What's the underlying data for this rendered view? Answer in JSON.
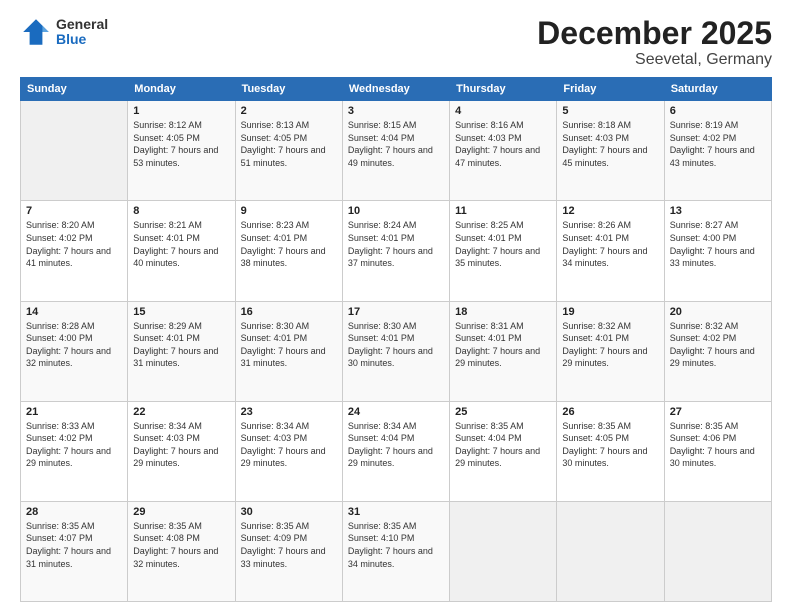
{
  "logo": {
    "general": "General",
    "blue": "Blue"
  },
  "title": "December 2025",
  "subtitle": "Seevetal, Germany",
  "weekdays": [
    "Sunday",
    "Monday",
    "Tuesday",
    "Wednesday",
    "Thursday",
    "Friday",
    "Saturday"
  ],
  "weeks": [
    [
      {
        "day": "",
        "sunrise": "",
        "sunset": "",
        "daylight": ""
      },
      {
        "day": "1",
        "sunrise": "Sunrise: 8:12 AM",
        "sunset": "Sunset: 4:05 PM",
        "daylight": "Daylight: 7 hours and 53 minutes."
      },
      {
        "day": "2",
        "sunrise": "Sunrise: 8:13 AM",
        "sunset": "Sunset: 4:05 PM",
        "daylight": "Daylight: 7 hours and 51 minutes."
      },
      {
        "day": "3",
        "sunrise": "Sunrise: 8:15 AM",
        "sunset": "Sunset: 4:04 PM",
        "daylight": "Daylight: 7 hours and 49 minutes."
      },
      {
        "day": "4",
        "sunrise": "Sunrise: 8:16 AM",
        "sunset": "Sunset: 4:03 PM",
        "daylight": "Daylight: 7 hours and 47 minutes."
      },
      {
        "day": "5",
        "sunrise": "Sunrise: 8:18 AM",
        "sunset": "Sunset: 4:03 PM",
        "daylight": "Daylight: 7 hours and 45 minutes."
      },
      {
        "day": "6",
        "sunrise": "Sunrise: 8:19 AM",
        "sunset": "Sunset: 4:02 PM",
        "daylight": "Daylight: 7 hours and 43 minutes."
      }
    ],
    [
      {
        "day": "7",
        "sunrise": "Sunrise: 8:20 AM",
        "sunset": "Sunset: 4:02 PM",
        "daylight": "Daylight: 7 hours and 41 minutes."
      },
      {
        "day": "8",
        "sunrise": "Sunrise: 8:21 AM",
        "sunset": "Sunset: 4:01 PM",
        "daylight": "Daylight: 7 hours and 40 minutes."
      },
      {
        "day": "9",
        "sunrise": "Sunrise: 8:23 AM",
        "sunset": "Sunset: 4:01 PM",
        "daylight": "Daylight: 7 hours and 38 minutes."
      },
      {
        "day": "10",
        "sunrise": "Sunrise: 8:24 AM",
        "sunset": "Sunset: 4:01 PM",
        "daylight": "Daylight: 7 hours and 37 minutes."
      },
      {
        "day": "11",
        "sunrise": "Sunrise: 8:25 AM",
        "sunset": "Sunset: 4:01 PM",
        "daylight": "Daylight: 7 hours and 35 minutes."
      },
      {
        "day": "12",
        "sunrise": "Sunrise: 8:26 AM",
        "sunset": "Sunset: 4:01 PM",
        "daylight": "Daylight: 7 hours and 34 minutes."
      },
      {
        "day": "13",
        "sunrise": "Sunrise: 8:27 AM",
        "sunset": "Sunset: 4:00 PM",
        "daylight": "Daylight: 7 hours and 33 minutes."
      }
    ],
    [
      {
        "day": "14",
        "sunrise": "Sunrise: 8:28 AM",
        "sunset": "Sunset: 4:00 PM",
        "daylight": "Daylight: 7 hours and 32 minutes."
      },
      {
        "day": "15",
        "sunrise": "Sunrise: 8:29 AM",
        "sunset": "Sunset: 4:01 PM",
        "daylight": "Daylight: 7 hours and 31 minutes."
      },
      {
        "day": "16",
        "sunrise": "Sunrise: 8:30 AM",
        "sunset": "Sunset: 4:01 PM",
        "daylight": "Daylight: 7 hours and 31 minutes."
      },
      {
        "day": "17",
        "sunrise": "Sunrise: 8:30 AM",
        "sunset": "Sunset: 4:01 PM",
        "daylight": "Daylight: 7 hours and 30 minutes."
      },
      {
        "day": "18",
        "sunrise": "Sunrise: 8:31 AM",
        "sunset": "Sunset: 4:01 PM",
        "daylight": "Daylight: 7 hours and 29 minutes."
      },
      {
        "day": "19",
        "sunrise": "Sunrise: 8:32 AM",
        "sunset": "Sunset: 4:01 PM",
        "daylight": "Daylight: 7 hours and 29 minutes."
      },
      {
        "day": "20",
        "sunrise": "Sunrise: 8:32 AM",
        "sunset": "Sunset: 4:02 PM",
        "daylight": "Daylight: 7 hours and 29 minutes."
      }
    ],
    [
      {
        "day": "21",
        "sunrise": "Sunrise: 8:33 AM",
        "sunset": "Sunset: 4:02 PM",
        "daylight": "Daylight: 7 hours and 29 minutes."
      },
      {
        "day": "22",
        "sunrise": "Sunrise: 8:34 AM",
        "sunset": "Sunset: 4:03 PM",
        "daylight": "Daylight: 7 hours and 29 minutes."
      },
      {
        "day": "23",
        "sunrise": "Sunrise: 8:34 AM",
        "sunset": "Sunset: 4:03 PM",
        "daylight": "Daylight: 7 hours and 29 minutes."
      },
      {
        "day": "24",
        "sunrise": "Sunrise: 8:34 AM",
        "sunset": "Sunset: 4:04 PM",
        "daylight": "Daylight: 7 hours and 29 minutes."
      },
      {
        "day": "25",
        "sunrise": "Sunrise: 8:35 AM",
        "sunset": "Sunset: 4:04 PM",
        "daylight": "Daylight: 7 hours and 29 minutes."
      },
      {
        "day": "26",
        "sunrise": "Sunrise: 8:35 AM",
        "sunset": "Sunset: 4:05 PM",
        "daylight": "Daylight: 7 hours and 30 minutes."
      },
      {
        "day": "27",
        "sunrise": "Sunrise: 8:35 AM",
        "sunset": "Sunset: 4:06 PM",
        "daylight": "Daylight: 7 hours and 30 minutes."
      }
    ],
    [
      {
        "day": "28",
        "sunrise": "Sunrise: 8:35 AM",
        "sunset": "Sunset: 4:07 PM",
        "daylight": "Daylight: 7 hours and 31 minutes."
      },
      {
        "day": "29",
        "sunrise": "Sunrise: 8:35 AM",
        "sunset": "Sunset: 4:08 PM",
        "daylight": "Daylight: 7 hours and 32 minutes."
      },
      {
        "day": "30",
        "sunrise": "Sunrise: 8:35 AM",
        "sunset": "Sunset: 4:09 PM",
        "daylight": "Daylight: 7 hours and 33 minutes."
      },
      {
        "day": "31",
        "sunrise": "Sunrise: 8:35 AM",
        "sunset": "Sunset: 4:10 PM",
        "daylight": "Daylight: 7 hours and 34 minutes."
      },
      {
        "day": "",
        "sunrise": "",
        "sunset": "",
        "daylight": ""
      },
      {
        "day": "",
        "sunrise": "",
        "sunset": "",
        "daylight": ""
      },
      {
        "day": "",
        "sunrise": "",
        "sunset": "",
        "daylight": ""
      }
    ]
  ]
}
